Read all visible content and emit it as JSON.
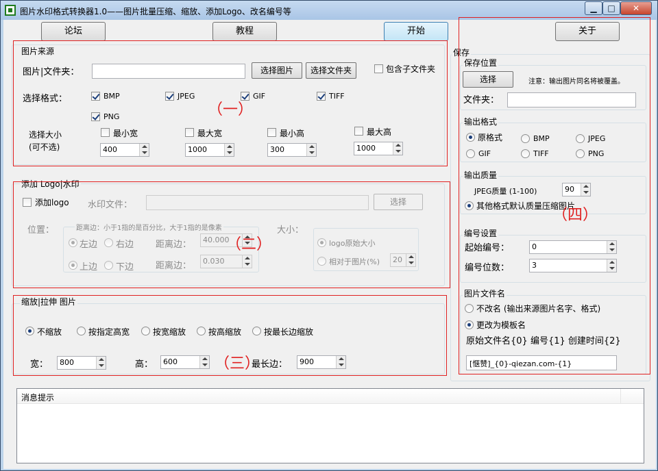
{
  "window": {
    "title": "图片水印格式转换器1.0——图片批量压缩、缩放、添加Logo、改名编号等",
    "min_label": "▁",
    "max_label": "□",
    "close_label": "✕"
  },
  "toolbar": {
    "forum_label": "论坛",
    "tutorial_label": "教程",
    "start_label": "开始",
    "about_label": "关于"
  },
  "source": {
    "group_label": "图片来源",
    "path_label": "图片|文件夹：",
    "path_value": "",
    "select_image_label": "选择图片",
    "select_folder_label": "选择文件夹",
    "include_sub_label": "包含子文件夹",
    "format_label": "选择格式：",
    "formats": [
      {
        "label": "BMP",
        "checked": true
      },
      {
        "label": "JPEG",
        "checked": true
      },
      {
        "label": "GIF",
        "checked": true
      },
      {
        "label": "TIFF",
        "checked": true
      },
      {
        "label": "PNG",
        "checked": true
      }
    ],
    "size_label_1": "选择大小",
    "size_label_2": "(可不选)",
    "min_width_label": "最小宽",
    "max_width_label": "最大宽",
    "min_height_label": "最小高",
    "max_height_label": "最大高",
    "min_width_value": "400",
    "max_width_value": "1000",
    "min_height_value": "300",
    "max_height_value": "1000"
  },
  "logo": {
    "group_label": "添加 Logo|水印",
    "add_logo_label": "添加logo",
    "file_label": "水印文件：",
    "file_value": "",
    "select_label": "选择",
    "position_label": "位置：",
    "hint": "距离边：小于1指的是百分比，大于1指的是像素",
    "left_label": "左边",
    "right_label": "右边",
    "top_label": "上边",
    "bottom_label": "下边",
    "distance_label": "距离边：",
    "distance_h_value": "40.000",
    "distance_v_value": "0.030",
    "size_label": "大小：",
    "original_size_label": "logo原始大小",
    "relative_label": "相对于图片(%)",
    "relative_value": "20"
  },
  "resize": {
    "group_label": "缩放|拉伸 图片",
    "options": [
      "不缩放",
      "按指定高宽",
      "按宽缩放",
      "按高缩放",
      "按最长边缩放"
    ],
    "selected": 0,
    "width_label": "宽：",
    "width_value": "800",
    "height_label": "高：",
    "height_value": "600",
    "longest_label": "最长边：",
    "longest_value": "900"
  },
  "save": {
    "section_label": "保存",
    "location_group": "保存位置",
    "select_label": "选择",
    "note": "注意：输出图片同名将被覆盖。",
    "folder_label": "文件夹：",
    "folder_value": "",
    "format_group": "输出格式",
    "formats": [
      "原格式",
      "BMP",
      "JPEG",
      "GIF",
      "TIFF",
      "PNG"
    ],
    "selected_format": 0,
    "quality_group": "输出质量",
    "jpeg_quality_label": "JPEG质量 (1-100)",
    "jpeg_quality_value": "90",
    "other_quality_label": "其他格式默认质量压缩图片",
    "numbering_group": "编号设置",
    "start_number_label": "起始编号：",
    "start_number_value": "0",
    "digits_label": "编号位数：",
    "digits_value": "3",
    "filename_group": "图片文件名",
    "no_rename_label": "不改名 (输出来源图片名字、格式)",
    "template_label": "更改为模板名",
    "template_help": "原始文件名{0} 编号{1} 创建时间{2}",
    "template_value": "[惬赞]_{0}-qiezan.com-{1}"
  },
  "annotations": {
    "one": "（一）",
    "two": "（二）",
    "three": "（三）",
    "four": "（四）"
  },
  "messages": {
    "header": "消息提示"
  }
}
